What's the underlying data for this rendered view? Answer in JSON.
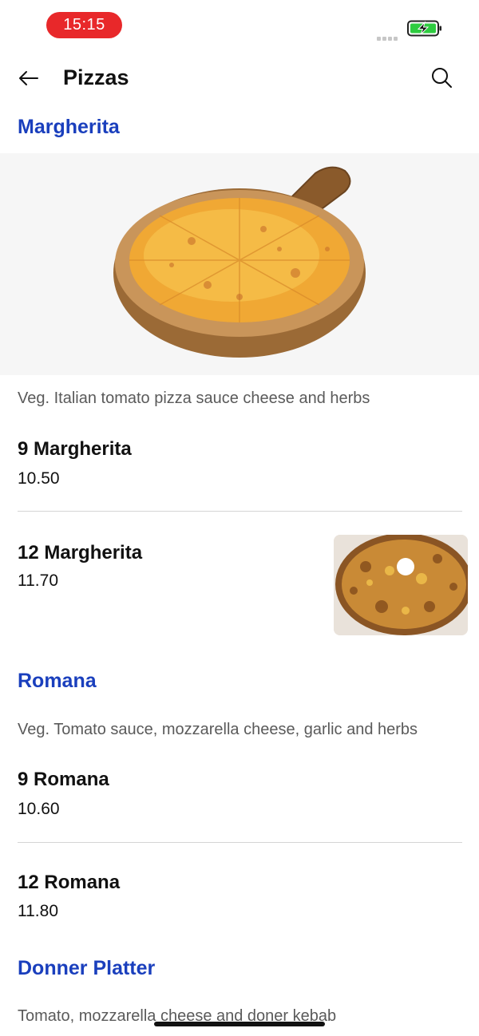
{
  "status_bar": {
    "time": "15:15"
  },
  "header": {
    "title": "Pizzas",
    "back_icon": "arrow-left-icon",
    "search_icon": "search-icon"
  },
  "sections": [
    {
      "title": "Margherita",
      "description": "Veg. Italian tomato pizza sauce cheese and herbs",
      "items": [
        {
          "name": "9 Margherita",
          "price": "10.50"
        },
        {
          "name": "12 Margherita",
          "price": "11.70"
        }
      ]
    },
    {
      "title": "Romana",
      "description": "Veg. Tomato sauce, mozzarella cheese, garlic and herbs",
      "items": [
        {
          "name": "9 Romana",
          "price": "10.60"
        },
        {
          "name": "12 Romana",
          "price": "11.80"
        }
      ]
    },
    {
      "title": "Donner Platter",
      "description": "Tomato, mozzarella cheese and doner kebab",
      "items": []
    }
  ],
  "colors": {
    "accent": "#1a3fbd",
    "time_pill": "#e8282a",
    "battery": "#2ecc40"
  }
}
